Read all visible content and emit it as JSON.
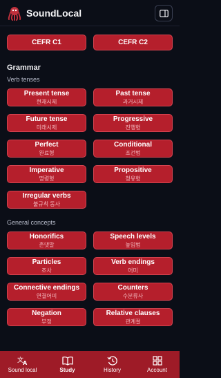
{
  "app": {
    "title": "SoundLocal"
  },
  "levels": [
    "CEFR C1",
    "CEFR C2"
  ],
  "grammar": {
    "title": "Grammar",
    "verb_tenses": {
      "title": "Verb tenses",
      "items": [
        {
          "label": "Present tense",
          "sub": "현재시제"
        },
        {
          "label": "Past tense",
          "sub": "과거시제"
        },
        {
          "label": "Future tense",
          "sub": "미래시제"
        },
        {
          "label": "Progressive",
          "sub": "진행형"
        },
        {
          "label": "Perfect",
          "sub": "완료형"
        },
        {
          "label": "Conditional",
          "sub": "조건법"
        },
        {
          "label": "Imperative",
          "sub": "명령형"
        },
        {
          "label": "Propositive",
          "sub": "청유형"
        },
        {
          "label": "Irregular verbs",
          "sub": "불규칙 동사"
        }
      ]
    },
    "general_concepts": {
      "title": "General concepts",
      "items": [
        {
          "label": "Honorifics",
          "sub": "존댓말"
        },
        {
          "label": "Speech levels",
          "sub": "높임법"
        },
        {
          "label": "Particles",
          "sub": "조사"
        },
        {
          "label": "Verb endings",
          "sub": "어미"
        },
        {
          "label": "Connective endings",
          "sub": "연결어미"
        },
        {
          "label": "Counters",
          "sub": "수분류사"
        },
        {
          "label": "Negation",
          "sub": "부정"
        },
        {
          "label": "Relative clauses",
          "sub": "관계절"
        }
      ]
    }
  },
  "nav": [
    {
      "label": "Sound local",
      "icon": "translate-icon"
    },
    {
      "label": "Study",
      "icon": "book-icon"
    },
    {
      "label": "History",
      "icon": "history-icon"
    },
    {
      "label": "Account",
      "icon": "grid-icon"
    }
  ],
  "colors": {
    "accent": "#b51f2c",
    "background": "#0b0e17",
    "nav": "#9e1b27"
  }
}
